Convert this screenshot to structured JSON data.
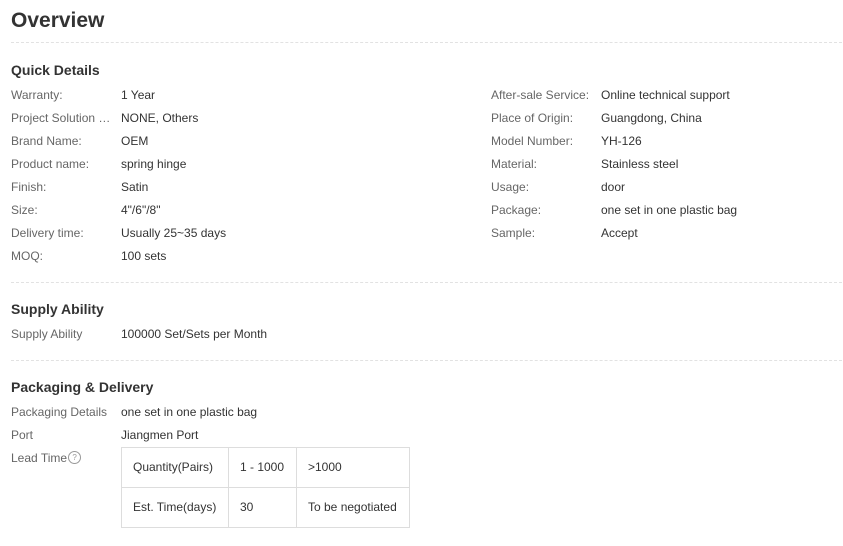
{
  "overview": {
    "title": "Overview"
  },
  "quick_details": {
    "title": "Quick Details",
    "left": [
      {
        "label": "Warranty:",
        "value": "1 Year"
      },
      {
        "label": "Project Solution Ca...",
        "value": "NONE, Others"
      },
      {
        "label": "Brand Name:",
        "value": "OEM"
      },
      {
        "label": "Product name:",
        "value": "spring hinge"
      },
      {
        "label": "Finish:",
        "value": "Satin"
      },
      {
        "label": "Size:",
        "value": "4\"/6\"/8\""
      },
      {
        "label": "Delivery time:",
        "value": "Usually 25~35 days"
      },
      {
        "label": "MOQ:",
        "value": "100 sets"
      }
    ],
    "right": [
      {
        "label": "After-sale Service:",
        "value": "Online technical support"
      },
      {
        "label": "Place of Origin:",
        "value": "Guangdong, China"
      },
      {
        "label": "Model Number:",
        "value": "YH-126"
      },
      {
        "label": "Material:",
        "value": "Stainless steel"
      },
      {
        "label": "Usage:",
        "value": "door"
      },
      {
        "label": "Package:",
        "value": "one set in one plastic bag"
      },
      {
        "label": "Sample:",
        "value": "Accept"
      }
    ]
  },
  "supply_ability": {
    "title": "Supply Ability",
    "rows": [
      {
        "label": "Supply Ability",
        "value": "100000 Set/Sets per Month"
      }
    ]
  },
  "packaging": {
    "title": "Packaging & Delivery",
    "rows": [
      {
        "label": "Packaging Details",
        "value": "one set in one plastic bag"
      },
      {
        "label": "Port",
        "value": "Jiangmen Port"
      }
    ],
    "lead_time_label": "Lead Time",
    "help_icon_glyph": "?",
    "lead_table": [
      [
        "Quantity(Pairs)",
        "1 - 1000",
        ">1000"
      ],
      [
        "Est. Time(days)",
        "30",
        "To be negotiated"
      ]
    ]
  },
  "icons": {
    "help": "question-circle-icon"
  },
  "colors": {
    "text": "#333333",
    "label": "#666666",
    "divider": "#e2e2e2",
    "table_border": "#dddddd"
  }
}
